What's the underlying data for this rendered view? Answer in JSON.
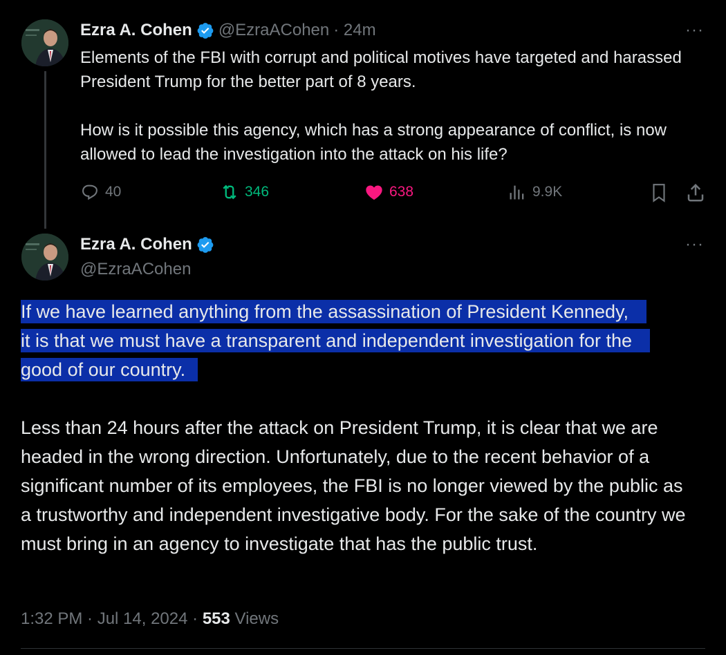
{
  "tweet1": {
    "name": "Ezra A. Cohen",
    "handle": "@EzraACohen",
    "time": "· 24m",
    "more": "···",
    "text": "Elements of the FBI with corrupt and political motives have targeted and harassed President Trump for the better part of 8 years.\n\nHow is it possible this agency, which has a strong appearance of conflict, is now allowed to lead the investigation into the attack on his life?",
    "replies": "40",
    "reposts": "346",
    "likes": "638",
    "views": "9.9K"
  },
  "tweet2": {
    "name": "Ezra A. Cohen",
    "handle": "@EzraACohen",
    "more": "···",
    "highlighted_text": "If we have learned anything from the assassination of President Kennedy, it is that we must have a transparent and independent investigation for the good of our country.",
    "body_text": "Less than 24 hours after the attack on President Trump, it is clear that we are headed in the wrong direction. Unfortunately, due to the recent behavior of a significant number of its employees, the FBI is no longer viewed by the public as a trustworthy and independent investigative body. For the sake of the country we must bring in an agency to investigate that has the public trust.",
    "timestamp": "1:32 PM · Jul 14, 2024 · ",
    "views_count": "553",
    "views_label": " Views"
  },
  "colors": {
    "background": "#000000",
    "text": "#e7e9ea",
    "muted": "#71767b",
    "verified": "#1d9bf0",
    "repost": "#00ba7c",
    "like": "#f91880",
    "highlight": "#0b2fa8"
  },
  "icons": [
    "verified-badge-icon",
    "more-icon",
    "reply-icon",
    "repost-icon",
    "like-icon",
    "views-icon",
    "bookmark-icon",
    "share-icon"
  ]
}
